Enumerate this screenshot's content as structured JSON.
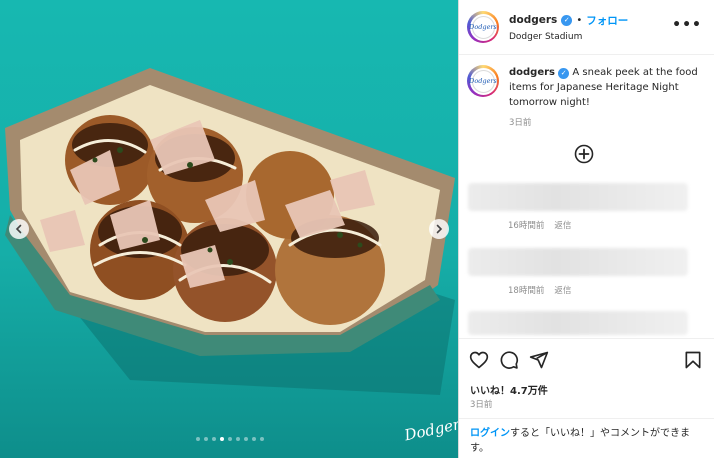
{
  "post": {
    "username": "dodgers",
    "avatar_text": "Dodgers",
    "follow_label": "フォロー",
    "separator": "•",
    "location": "Dodger Stadium",
    "more_label": "•••",
    "verified_mark": "✓",
    "caption": "A sneak peek at the food items for Japanese Heritage Night tomorrow night!",
    "caption_time": "3日前",
    "watermark": "Dodgers",
    "carousel": {
      "slide_count": 9,
      "active_index": 3
    }
  },
  "comments": [
    {
      "time": "16時間前",
      "reply_label": "返信"
    },
    {
      "time": "18時間前",
      "reply_label": "返信"
    },
    {
      "time": "",
      "reply_label": ""
    }
  ],
  "stats": {
    "likes_label": "いいね！4.7万件",
    "post_time": "3日前"
  },
  "login": {
    "link": "ログイン",
    "rest": "すると「いいね！」やコメントができます。"
  },
  "icons": [
    "chevron-left-icon",
    "chevron-right-icon",
    "add-circle-icon",
    "heart-icon",
    "comment-icon",
    "share-icon",
    "bookmark-icon",
    "more-icon",
    "verified-icon"
  ],
  "colors": {
    "accent": "#0095f6",
    "verified": "#3897f0",
    "image_bg": "#17b8b1"
  }
}
